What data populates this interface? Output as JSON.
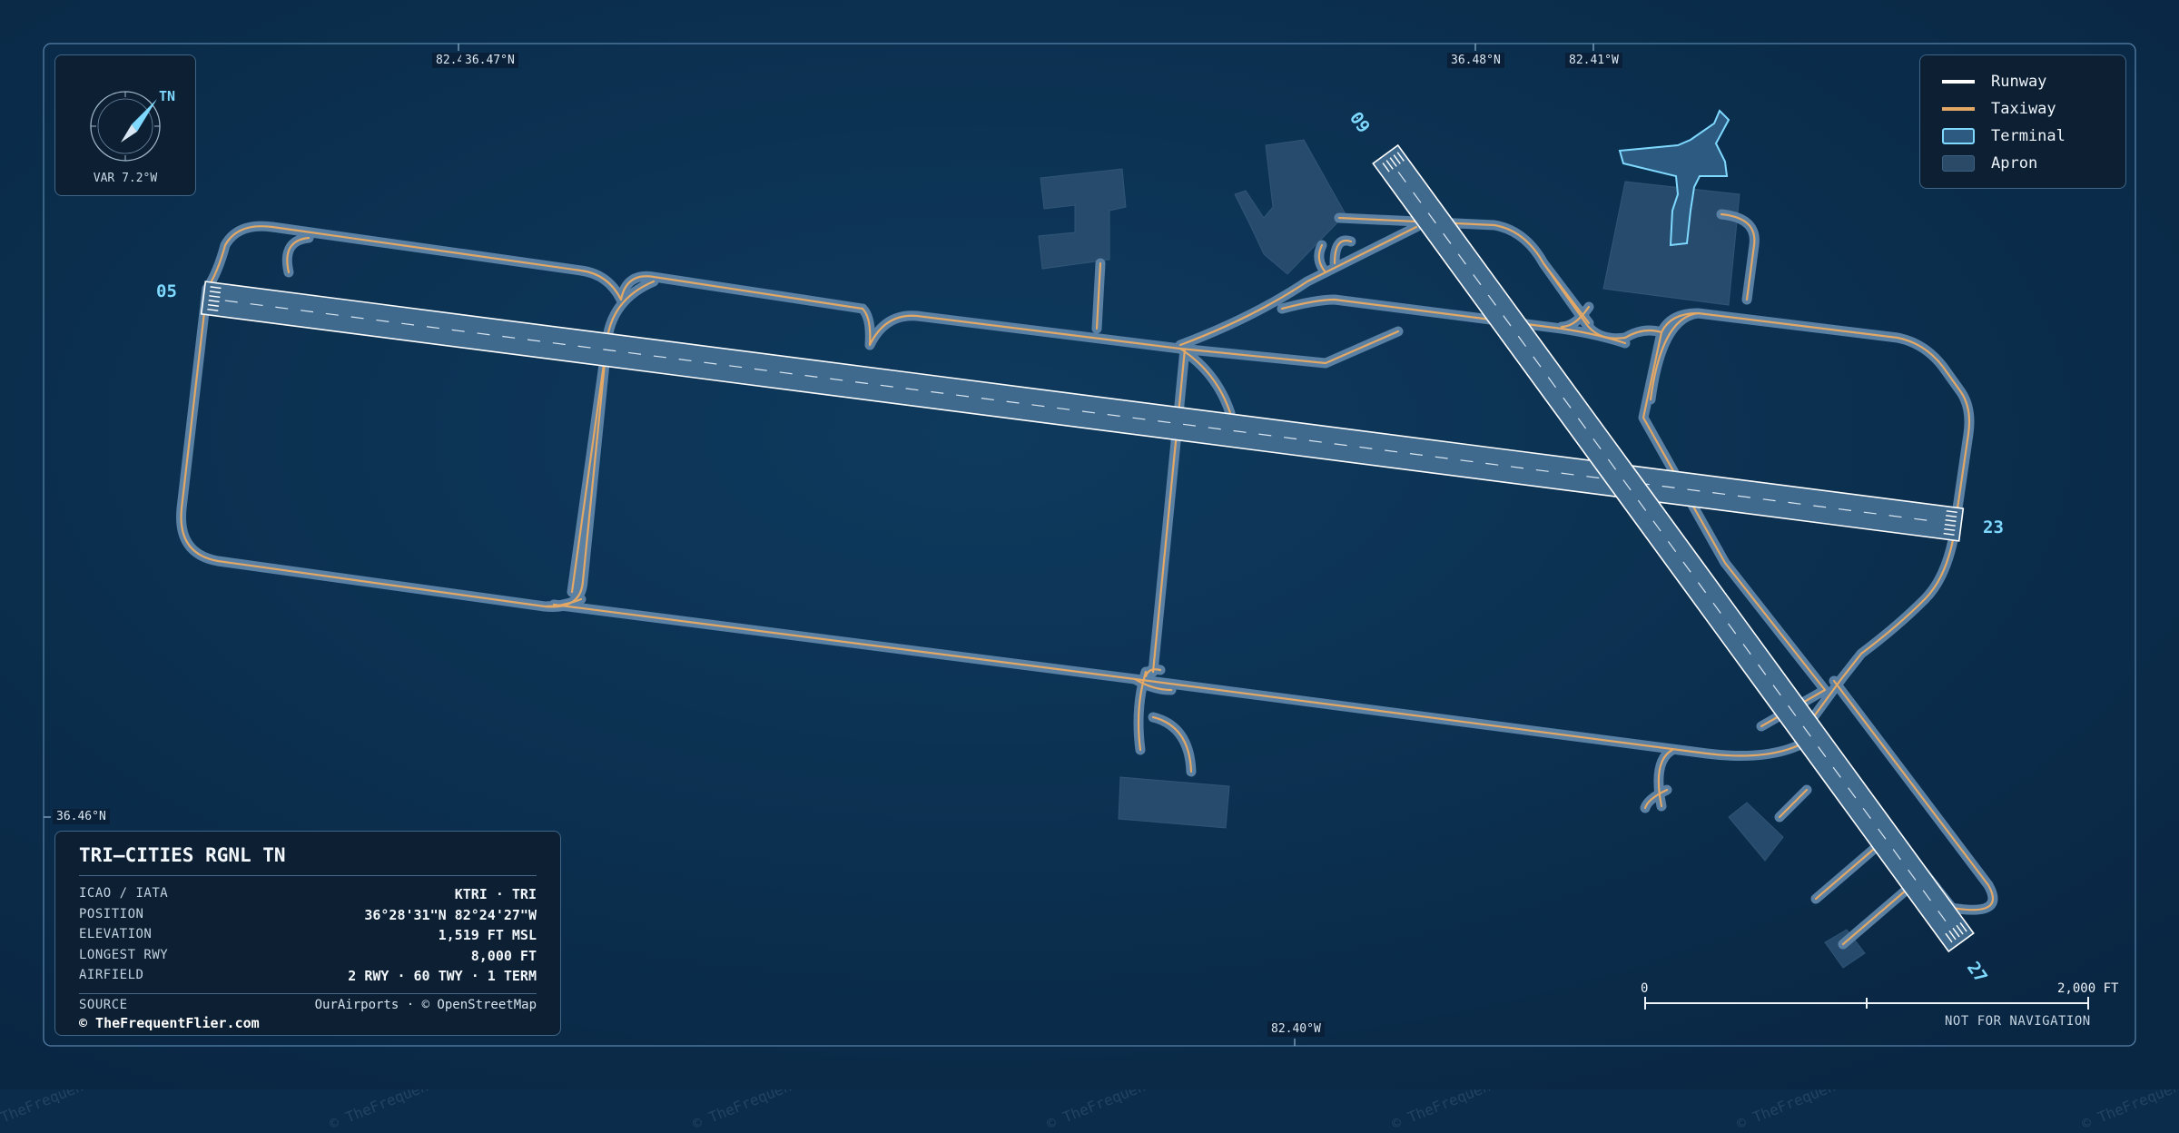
{
  "map": {
    "coords": {
      "top_left_lon": "82.4",
      "top_lat_1": "36.47°N",
      "top_lat_2": "36.48°N",
      "top_lon_2": "82.41°W",
      "left_lat": "36.46°N",
      "bottom_lon": "82.40°W"
    },
    "compass": {
      "north_label": "TN",
      "variation": "VAR 7.2°W"
    },
    "legend": {
      "items": [
        {
          "label": "Runway",
          "color": "#ffffff"
        },
        {
          "label": "Taxiway",
          "color": "#e3a865"
        },
        {
          "label": "Terminal",
          "color": "#7fd9ff"
        },
        {
          "label": "Apron",
          "color": "#2a4a68"
        }
      ]
    },
    "runways": {
      "rwy_05": "05",
      "rwy_23": "23",
      "rwy_09": "09",
      "rwy_27": "27"
    },
    "colors": {
      "background": "#0b2c4a",
      "taxiway_edge": "#5a80a4",
      "taxiway_center": "#e3a865",
      "runway_fill": "#3f6a8e",
      "terminal_outline": "#7fd9ff"
    },
    "info": {
      "title": "TRI–CITIES RGNL TN",
      "rows": [
        {
          "key": "ICAO / IATA",
          "value": "KTRI · TRI"
        },
        {
          "key": "POSITION",
          "value": "36°28'31\"N 82°24'27\"W"
        },
        {
          "key": "ELEVATION",
          "value": "1,519 FT MSL"
        },
        {
          "key": "LONGEST RWY",
          "value": "8,000 FT"
        },
        {
          "key": "AIRFIELD",
          "value": "2 RWY · 60 TWY · 1 TERM"
        }
      ],
      "source_key": "SOURCE",
      "source_value": "OurAirports · © OpenStreetMap",
      "copyright": "© TheFrequentFlier.com"
    },
    "scale": {
      "start": "0",
      "end": "2,000 FT"
    },
    "disclaimer": "NOT FOR NAVIGATION",
    "watermark": "© TheFrequentFlier.com"
  }
}
